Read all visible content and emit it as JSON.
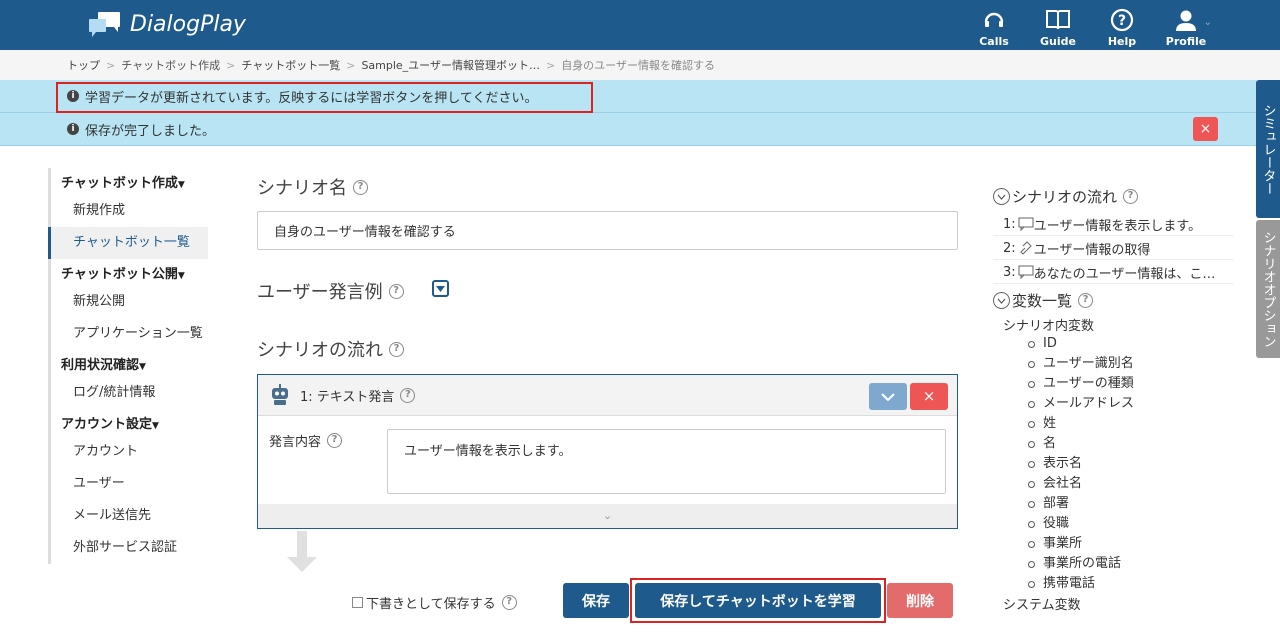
{
  "header": {
    "logo_text": "DialogPlay",
    "nav": [
      {
        "label": "Calls",
        "icon": "headset-icon"
      },
      {
        "label": "Guide",
        "icon": "book-icon"
      },
      {
        "label": "Help",
        "icon": "question-icon"
      },
      {
        "label": "Profile",
        "icon": "user-icon"
      }
    ]
  },
  "breadcrumb": {
    "items": [
      "トップ",
      "チャットボット作成",
      "チャットボット一覧",
      "Sample_ユーザー情報管理ボット…"
    ],
    "current": "自身のユーザー情報を確認する",
    "sep": ">"
  },
  "alerts": {
    "learn": "学習データが更新されています。反映するには学習ボタンを押してください。",
    "saved": "保存が完了しました。",
    "close": "×"
  },
  "side_tabs": {
    "simulator": "シミュレーター",
    "options": "シナリオオプション"
  },
  "menu": {
    "sections": [
      {
        "title": "チャットボット作成",
        "items": [
          "新規作成",
          "チャットボット一覧"
        ]
      },
      {
        "title": "チャットボット公開",
        "items": [
          "新規公開",
          "アプリケーション一覧"
        ]
      },
      {
        "title": "利用状況確認",
        "items": [
          "ログ/統計情報"
        ]
      },
      {
        "title": "アカウント設定",
        "items": [
          "アカウント",
          "ユーザー",
          "メール送信先",
          "外部サービス認証"
        ]
      }
    ],
    "active": "チャットボット一覧"
  },
  "main": {
    "scenario_name_label": "シナリオ名",
    "scenario_name_value": "自身のユーザー情報を確認する",
    "user_utterance_label": "ユーザー発言例",
    "flow_label": "シナリオの流れ",
    "card": {
      "title": "1: テキスト発言",
      "field_label": "発言内容",
      "field_value": "ユーザー情報を表示します。",
      "delete": "×"
    },
    "draft_label": "下書きとして保存する",
    "save": "保存",
    "save_learn": "保存してチャットボットを学習",
    "delete": "削除"
  },
  "right": {
    "flow_title": "シナリオの流れ",
    "flow_items": [
      {
        "num": "1:",
        "text": "ユーザー情報を表示します。",
        "icon": "speech-bubble-icon"
      },
      {
        "num": "2:",
        "text": "ユーザー情報の取得",
        "icon": "link-icon"
      },
      {
        "num": "3:",
        "text": "あなたのユーザー情報は、こ…",
        "icon": "speech-bubble-icon"
      }
    ],
    "var_title": "変数一覧",
    "scenario_vars_label": "シナリオ内変数",
    "scenario_vars": [
      "ID",
      "ユーザー識別名",
      "ユーザーの種類",
      "メールアドレス",
      "姓",
      "名",
      "表示名",
      "会社名",
      "部署",
      "役職",
      "事業所",
      "事業所の電話",
      "携帯電話"
    ],
    "system_vars_label": "システム変数"
  },
  "colors": {
    "brand": "#1e5a8c",
    "alert_bg": "#b8e4f3",
    "danger": "#e55555",
    "highlight": "#dd2222"
  }
}
